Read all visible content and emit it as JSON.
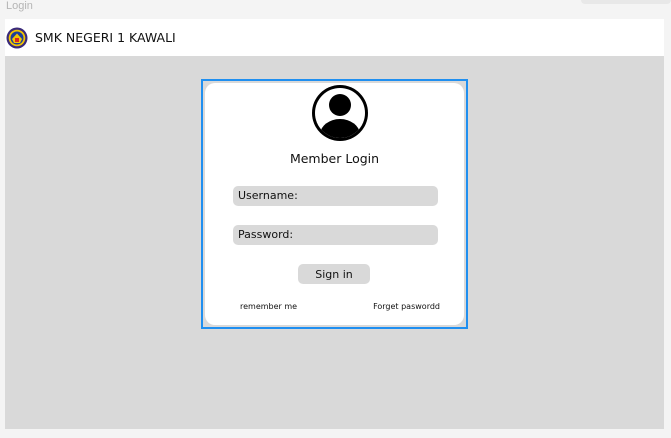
{
  "window": {
    "title": "Login"
  },
  "header": {
    "school_name": "SMK NEGERI 1 KAWALI",
    "logo_icon": "school-emblem-icon"
  },
  "login": {
    "title": "Member Login",
    "avatar_icon": "user-avatar-icon",
    "username_placeholder": "Username:",
    "password_placeholder": "Password:",
    "signin_label": "Sign in",
    "remember_label": "remember me",
    "forget_label": "Forget paswordd"
  },
  "colors": {
    "stage_bg": "#d9d9d9",
    "card_bg": "#ffffff",
    "frame_border": "#1f8ff0",
    "input_bg": "#d9d9d9"
  }
}
